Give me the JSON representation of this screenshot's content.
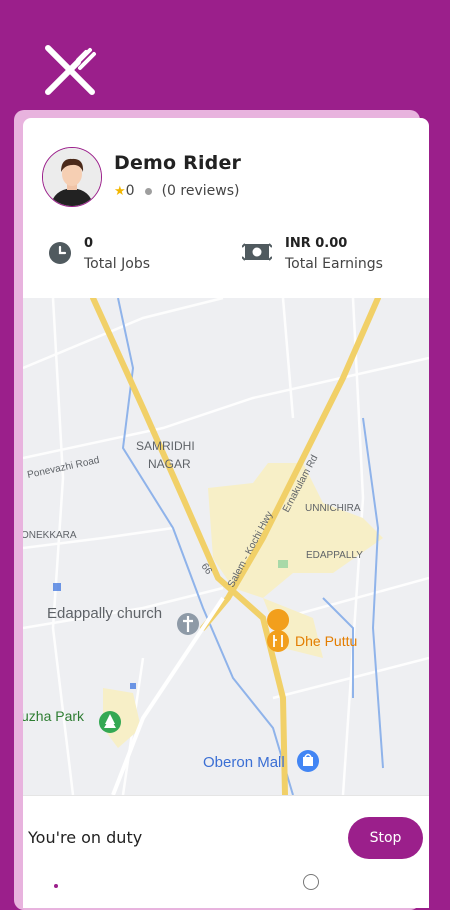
{
  "app": {
    "logo_icon": "fork-knife-icon",
    "brand_color": "#9b1f8b"
  },
  "profile": {
    "name": "Demo Rider",
    "rating": "0",
    "reviews": "(0 reviews)"
  },
  "stats": {
    "jobs_value": "0",
    "jobs_label": "Total Jobs",
    "earnings_value": "INR 0.00",
    "earnings_label": "Total Earnings"
  },
  "map": {
    "labels": {
      "samridhi_1": "SAMRIDHI",
      "samridhi_2": "NAGAR",
      "ponevazhi": "Ponevazhi Road",
      "onekkara": "ONEKKARA",
      "unnichira": "UNNICHIRA",
      "edappally": "EDAPPALLY",
      "ernakulam": "Ernakulam Rd",
      "salem": "Salem - Kochi Hwy",
      "route66": "66",
      "church": "Edappally church",
      "dhe_puttu": "Dhe Puttu",
      "park": "uzha Park",
      "oberon": "Oberon Mall"
    }
  },
  "duty": {
    "status_text": "You're on duty",
    "stop_label": "Stop"
  }
}
